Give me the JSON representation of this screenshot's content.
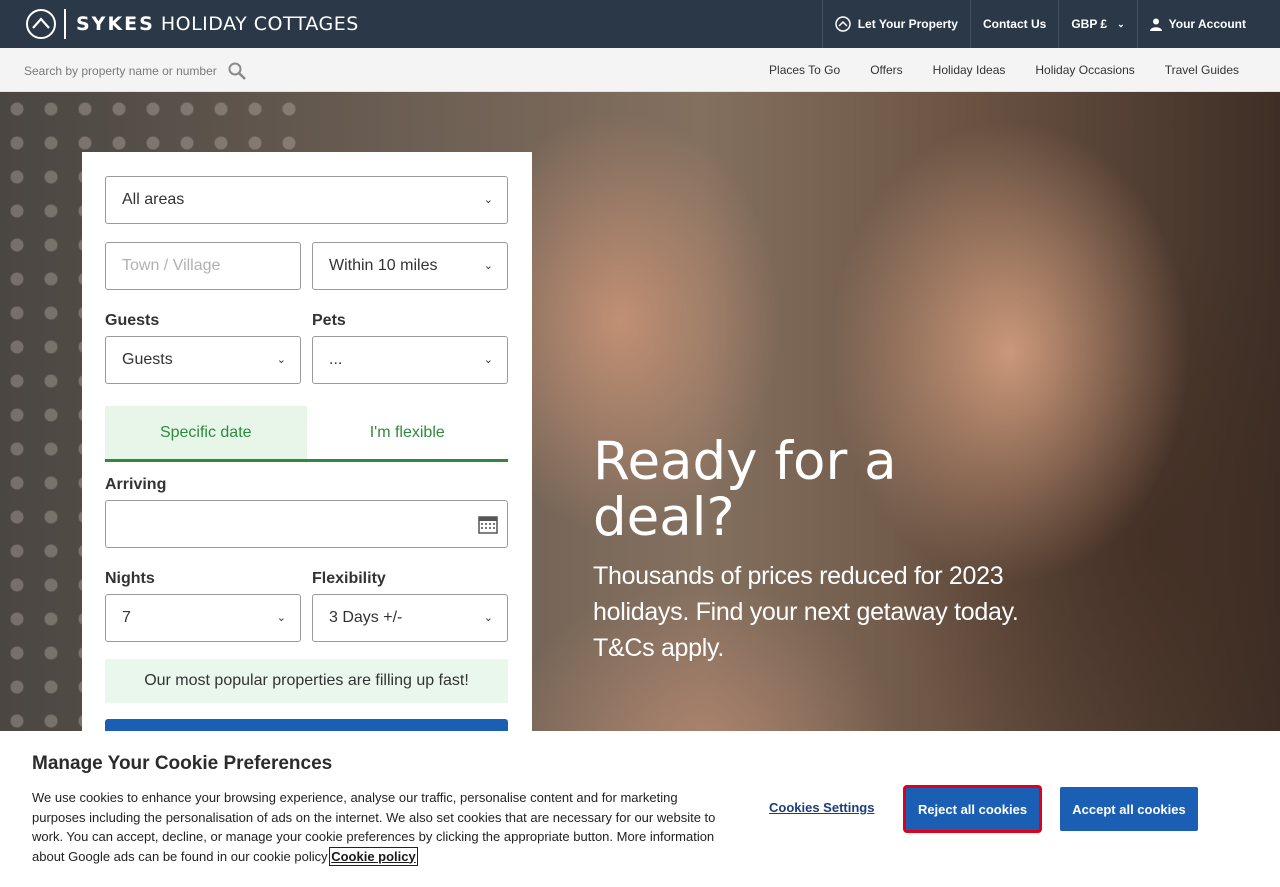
{
  "brand": {
    "bold": "SYKES",
    "rest": "HOLIDAY COTTAGES"
  },
  "topnav": {
    "let_property": "Let Your Property",
    "contact": "Contact Us",
    "currency": "GBP £",
    "account": "Your Account"
  },
  "search": {
    "placeholder": "Search by property name or number"
  },
  "subnav": [
    "Places To Go",
    "Offers",
    "Holiday Ideas",
    "Holiday Occasions",
    "Travel Guides"
  ],
  "form": {
    "area": "All areas",
    "town_placeholder": "Town / Village",
    "radius": "Within 10 miles",
    "guests_label": "Guests",
    "guests_value": "Guests",
    "pets_label": "Pets",
    "pets_value": "...",
    "tab_specific": "Specific date",
    "tab_flexible": "I'm flexible",
    "arriving_label": "Arriving",
    "nights_label": "Nights",
    "nights_value": "7",
    "flex_label": "Flexibility",
    "flex_value": "3 Days +/-",
    "notice": "Our most popular properties are filling up fast!"
  },
  "hero": {
    "title": "Ready for a deal?",
    "text": "Thousands of prices reduced for 2023 holidays. Find your next getaway today. T&Cs apply."
  },
  "cookie": {
    "title": "Manage Your Cookie Preferences",
    "body": "We use cookies to enhance your browsing experience, analyse our traffic, personalise content and for marketing purposes including the personalisation of ads on the internet.  We also set cookies that are necessary for our website to work.  You can accept, decline, or manage your cookie preferences by clicking the appropriate button. More information about Google ads can be found in our cookie policy ",
    "policy_link": "Cookie policy",
    "settings": "Cookies Settings",
    "reject": "Reject all cookies",
    "accept": "Accept all cookies"
  },
  "colors": {
    "topbar": "#2b3848",
    "green": "#2e8a3e",
    "blue": "#1a5fb4",
    "highlight": "#e0001b"
  },
  "icons": [
    "logo-mark-icon",
    "let-property-icon",
    "user-icon",
    "search-icon",
    "chevron-down-icon",
    "calendar-icon"
  ]
}
